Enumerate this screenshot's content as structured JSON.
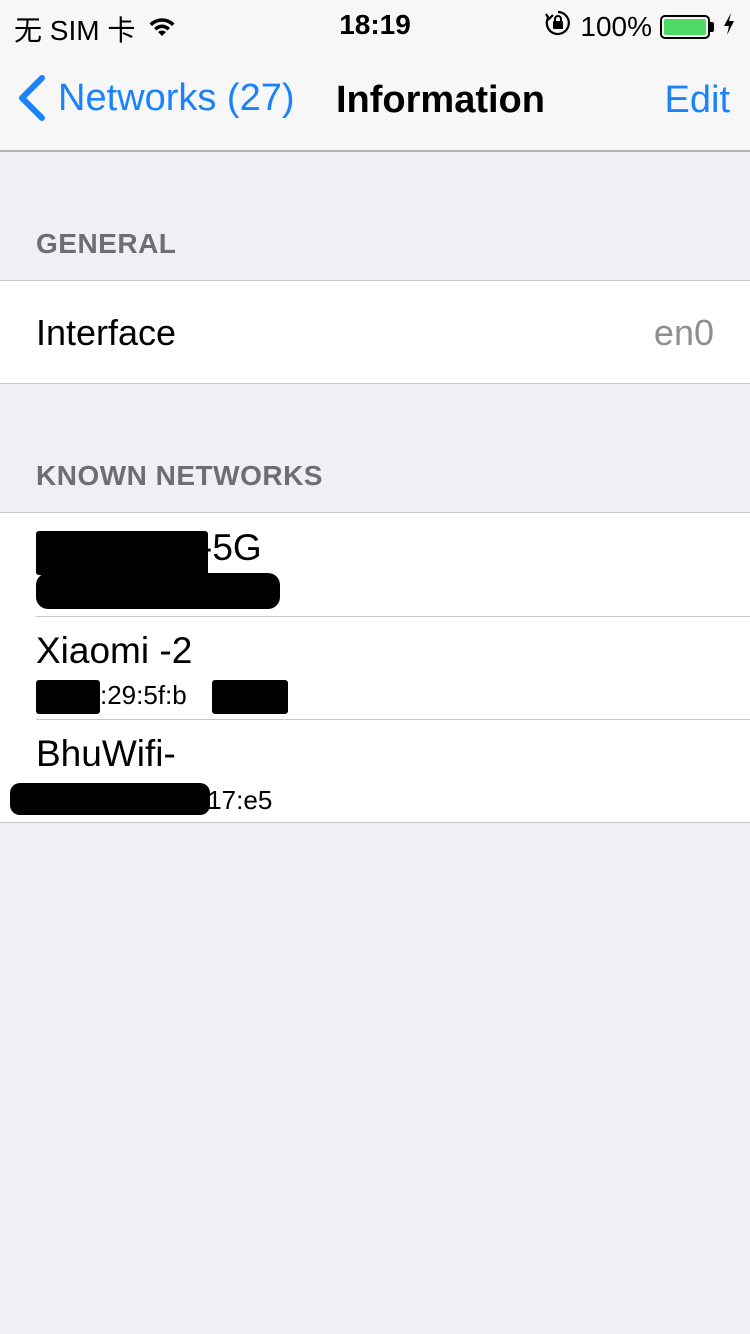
{
  "status_bar": {
    "carrier": "无 SIM 卡",
    "time": "18:19",
    "battery": "100%",
    "battery_level": 1.0,
    "icons": [
      "wifi-icon",
      "orientation-lock-icon",
      "battery-icon",
      "charging-icon"
    ]
  },
  "nav": {
    "back_label": "Networks (27)",
    "title": "Information",
    "edit_label": "Edit"
  },
  "general": {
    "header": "GENERAL",
    "rows": [
      {
        "label": "Interface",
        "value": "en0"
      }
    ]
  },
  "known_networks": {
    "header": "KNOWN NETWORKS",
    "items": [
      {
        "name": "-5G",
        "bssid": ""
      },
      {
        "name": "Xiaomi -2",
        "bssid": ":29:5f:b"
      },
      {
        "name": "BhuWifi-",
        "bssid": ":17:e5"
      }
    ]
  },
  "colors": {
    "accent": "#1a82fb",
    "background": "#efeff4",
    "secondary_text": "#8e8e93",
    "section_header": "#6d6d72",
    "battery_fill": "#4cd964"
  }
}
